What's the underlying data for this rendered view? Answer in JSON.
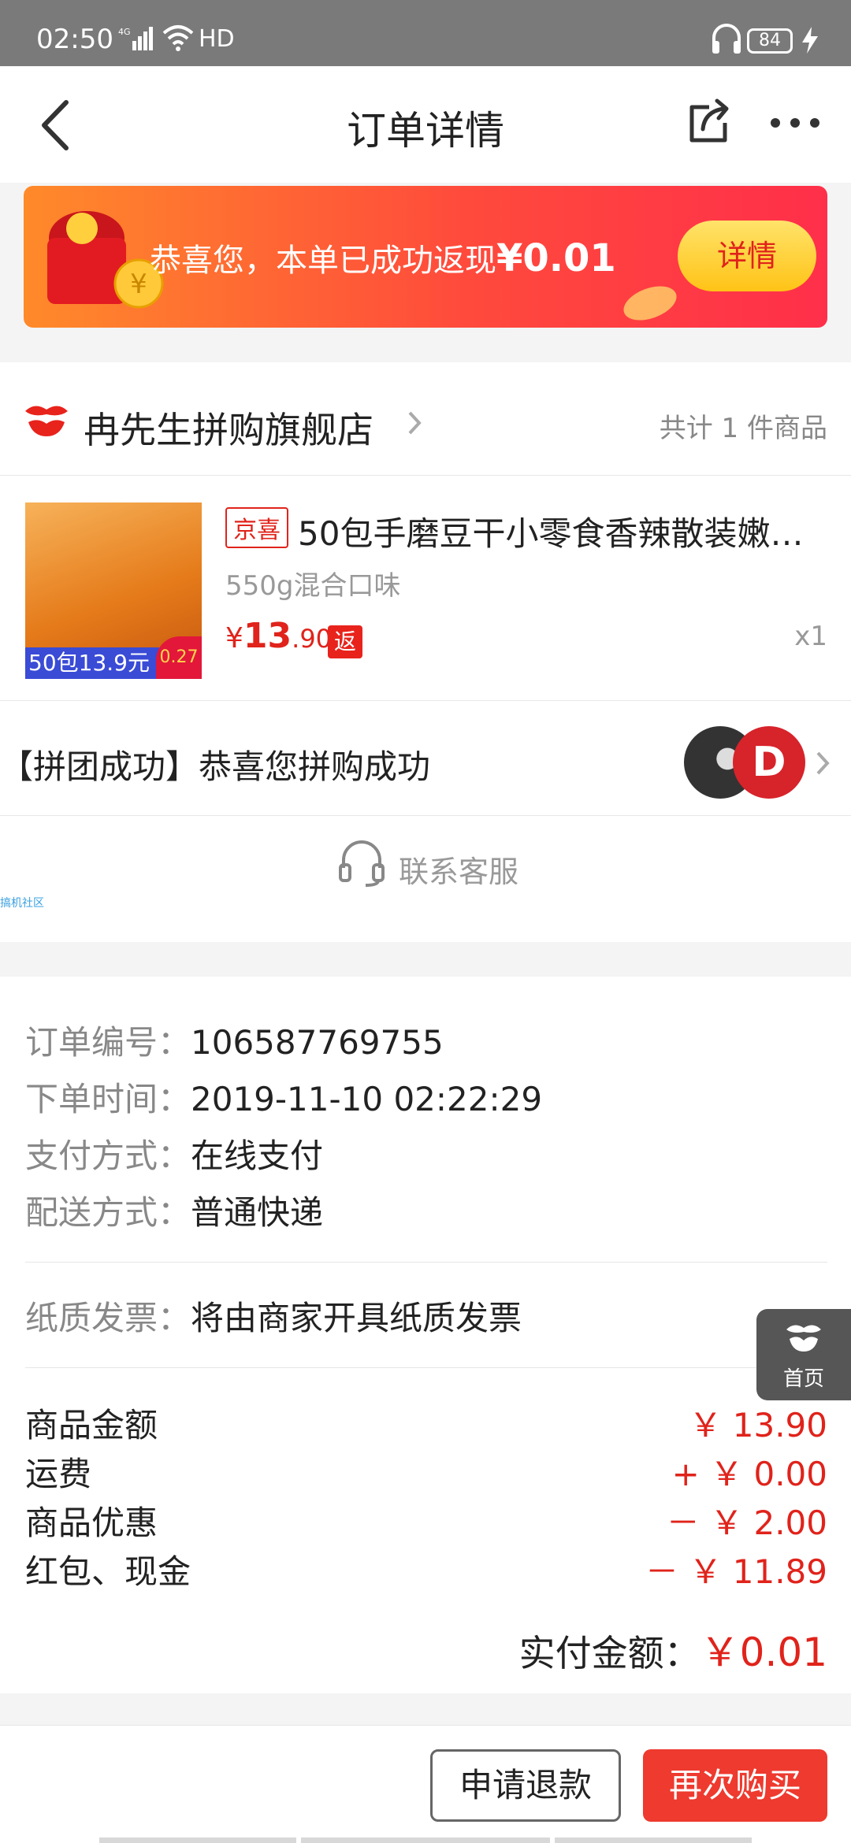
{
  "status_bar": {
    "time": "02:50",
    "network": "4G",
    "hd": "HD",
    "battery": "84"
  },
  "nav": {
    "title": "订单详情"
  },
  "banner": {
    "message": "恭喜您，本单已成功返现",
    "amount": "¥0.01",
    "button": "详情"
  },
  "store": {
    "name": "冉先生拼购旗舰店",
    "count_text": "共计 1 件商品",
    "product": {
      "tag": "京喜",
      "title": "50包手磨豆干小零食香辣散装嫩…",
      "spec": "550g混合口味",
      "price_symbol": "¥",
      "price_int": "13",
      "price_dec": ".90",
      "rebate_badge": "返",
      "qty": "x1",
      "thumb_caption": "50包13.9元",
      "thumb_badge": "0.27"
    },
    "group_text": "【拼团成功】恭喜您拼购成功",
    "avatar_letter": "D",
    "service_label": "联系客服",
    "watermark": "搞机社区"
  },
  "order_info": {
    "number_label": "订单编号：",
    "number": "106587769755",
    "time_label": "下单时间：",
    "time": "2019-11-10 02:22:29",
    "pay_label": "支付方式：",
    "pay": "在线支付",
    "ship_label": "配送方式：",
    "ship": "普通快递",
    "invoice_label": "纸质发票：",
    "invoice": "将由商家开具纸质发票"
  },
  "amounts": [
    {
      "label": "商品金额",
      "value": "￥ 13.90"
    },
    {
      "label": "运费",
      "value": "+ ￥ 0.00"
    },
    {
      "label": "商品优惠",
      "value": "－ ￥ 2.00"
    },
    {
      "label": "红包、现金",
      "value": "－ ￥ 11.89"
    }
  ],
  "total": {
    "label": "实付金额：",
    "value": "￥0.01"
  },
  "float_home": {
    "label": "首页"
  },
  "bottom": {
    "refund": "申请退款",
    "rebuy": "再次购买"
  },
  "colors": {
    "accent": "#e0231b",
    "button_red": "#ee3a2f",
    "banner_start": "#ff8a2a",
    "banner_end": "#ff2f4a"
  }
}
